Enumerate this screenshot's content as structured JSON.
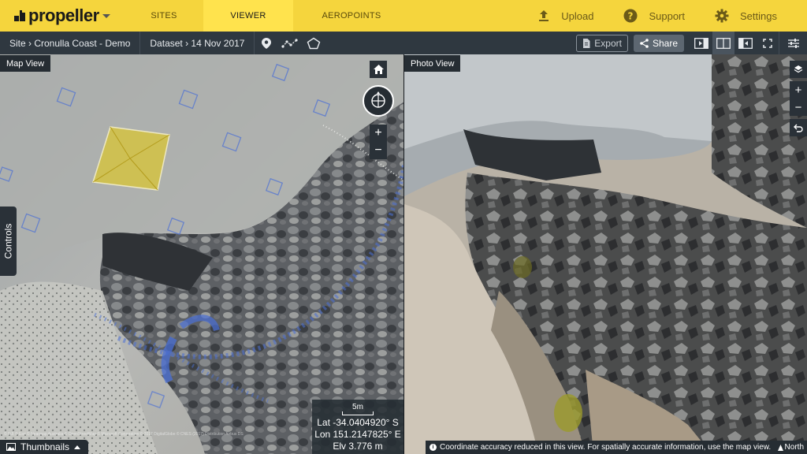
{
  "app": {
    "logo_text": "propeller"
  },
  "nav": {
    "sites": "SITES",
    "viewer": "VIEWER",
    "aeropoints": "AEROPOINTS"
  },
  "top_actions": {
    "upload": "Upload",
    "support": "Support",
    "settings": "Settings"
  },
  "breadcrumb": {
    "site": "Site › Cronulla Coast - Demo",
    "dataset": "Dataset › 14 Nov 2017"
  },
  "toolbar": {
    "export_label": "Export",
    "share_label": "Share"
  },
  "map_view": {
    "label": "Map View",
    "controls_label": "Controls",
    "thumbnails_label": "Thumbnails",
    "scale_label": "5m",
    "lat": "Lat -34.0404920° S",
    "lon": "Lon 151.2147825° E",
    "elv": "Elv 3.776 m",
    "attribution": "© DJI © Esri © Nearmap Australia © OpenStreetMap © Microsoft Corporation © 2017 DigitalGlobe © CNES (2017) Distribution Airbus DS"
  },
  "photo_view": {
    "label": "Photo View",
    "notice": "Coordinate accuracy reduced in this view. For spatially accurate information, use the map view.",
    "north_label": "North"
  },
  "colors": {
    "brand_yellow": "#f5d53d",
    "toolbar_bg": "#2f3840",
    "panel_bg": "#262d33",
    "gcp_marker": "#4a6fd6",
    "polygon_fill": "#d8c43a"
  }
}
